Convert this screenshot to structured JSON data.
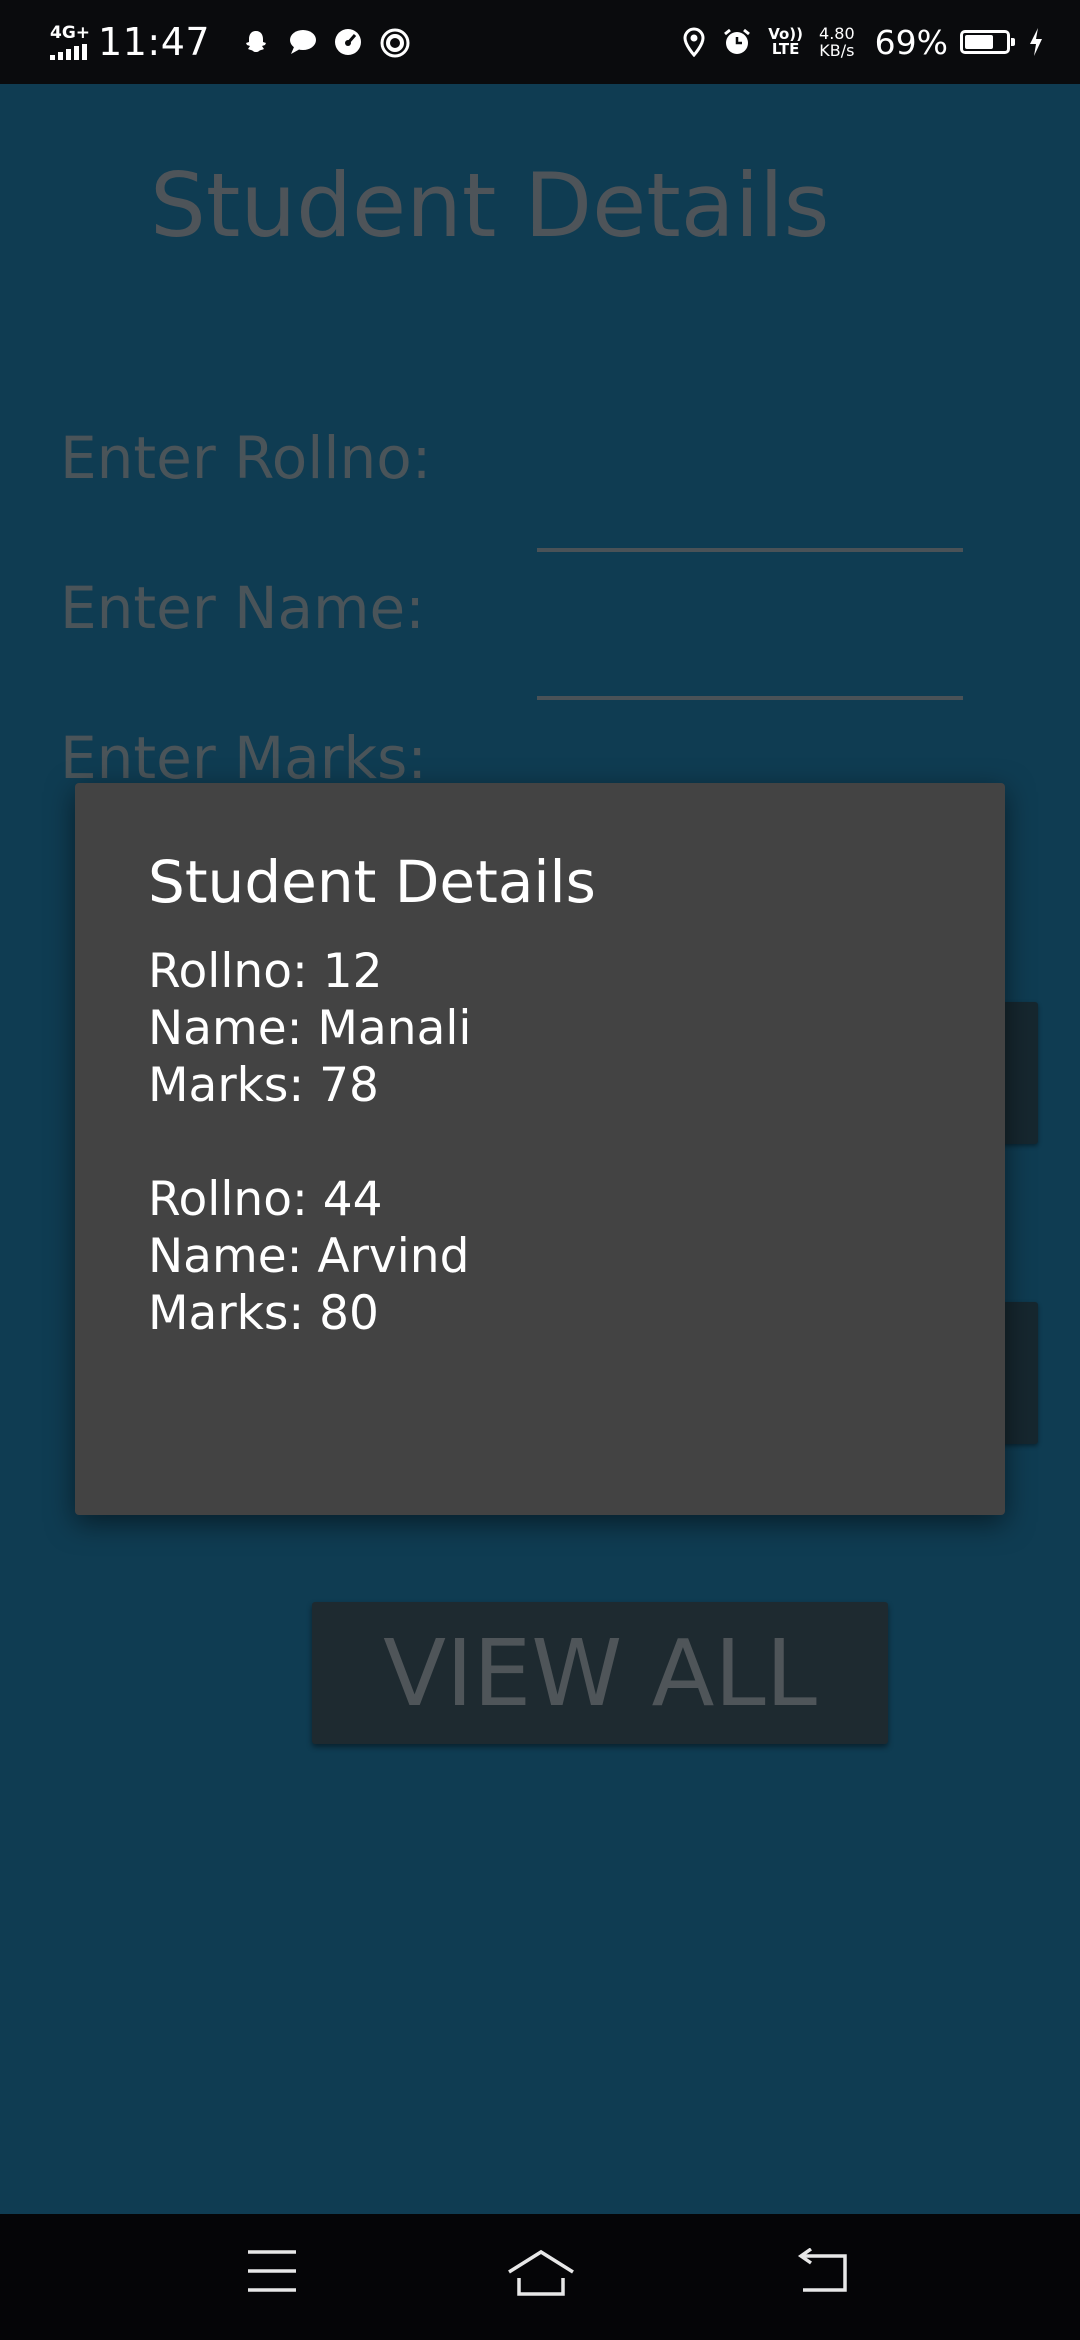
{
  "status_bar": {
    "network": "4G+",
    "time": "11:47",
    "notification_icons": [
      "snapchat-icon",
      "message-icon",
      "speedometer-icon",
      "circle-app-icon"
    ],
    "volte": "Vo))",
    "lte": "LTE",
    "speed_value": "4.80",
    "speed_unit": "KB/s",
    "battery_percent": "69%",
    "battery_level": 0.69
  },
  "app": {
    "title": "Student Details",
    "form": {
      "rollno_label": "Enter Rollno:",
      "name_label": "Enter Name:",
      "marks_label": "Enter Marks:"
    },
    "view_all_label": "VIEW ALL"
  },
  "dialog": {
    "title": "Student Details",
    "records": [
      {
        "rollno": "Rollno: 12",
        "name": "Name: Manali",
        "marks": "Marks: 78"
      },
      {
        "rollno": "Rollno: 44",
        "name": "Name: Arvind",
        "marks": "Marks: 80"
      }
    ]
  },
  "nav_bar": {
    "icons": [
      "menu-icon",
      "home-icon",
      "back-icon"
    ]
  },
  "colors": {
    "app_background": "#0f3c52",
    "dialog_background": "#434343",
    "dimmed_text": "#4e5459"
  }
}
